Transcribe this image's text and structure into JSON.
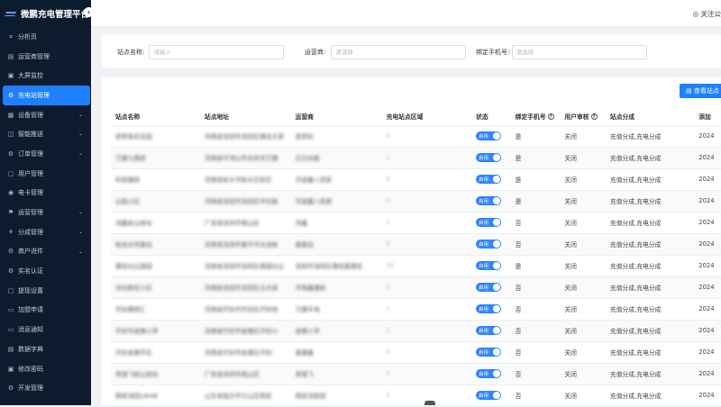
{
  "app": {
    "title": "微鹏充电管理平台",
    "collapse_icon": "‹"
  },
  "topbar": {
    "follow_label": "关注公"
  },
  "sidebar": {
    "items": [
      {
        "label": "分析页",
        "icon": "chart-icon",
        "glyph": "⌗",
        "arrow": false
      },
      {
        "label": "运营商管理",
        "icon": "doc-icon",
        "glyph": "▤",
        "arrow": false
      },
      {
        "label": "大屏监控",
        "icon": "monitor-icon",
        "glyph": "▣",
        "arrow": false
      },
      {
        "label": "充电站管理",
        "icon": "gear-icon",
        "glyph": "⚙",
        "arrow": false,
        "active": true
      },
      {
        "label": "设备管理",
        "icon": "device-icon",
        "glyph": "▦",
        "arrow": true
      },
      {
        "label": "智能推送",
        "icon": "push-icon",
        "glyph": "◫",
        "arrow": true
      },
      {
        "label": "订单管理",
        "icon": "order-icon",
        "glyph": "⚙",
        "arrow": true
      },
      {
        "label": "用户管理",
        "icon": "user-icon",
        "glyph": "▢",
        "arrow": false
      },
      {
        "label": "电卡管理",
        "icon": "card-icon",
        "glyph": "◉",
        "arrow": false
      },
      {
        "label": "运营管理",
        "icon": "operate-icon",
        "glyph": "⚑",
        "arrow": true
      },
      {
        "label": "分成管理",
        "icon": "share-icon",
        "glyph": "⚘",
        "arrow": true
      },
      {
        "label": "商户进件",
        "icon": "merchant-icon",
        "glyph": "⚙",
        "arrow": true
      },
      {
        "label": "实名认证",
        "icon": "verify-icon",
        "glyph": "⚙",
        "arrow": false
      },
      {
        "label": "提现设置",
        "icon": "withdraw-icon",
        "glyph": "▢",
        "arrow": false
      },
      {
        "label": "加盟申请",
        "icon": "apply-icon",
        "glyph": "▭",
        "arrow": false
      },
      {
        "label": "消息通知",
        "icon": "message-icon",
        "glyph": "▭",
        "arrow": false
      },
      {
        "label": "数据字典",
        "icon": "dict-icon",
        "glyph": "▤",
        "arrow": false
      },
      {
        "label": "修改密码",
        "icon": "lock-icon",
        "glyph": "▣",
        "arrow": false
      },
      {
        "label": "开发管理",
        "icon": "dev-icon",
        "glyph": "⚙",
        "arrow": false
      }
    ]
  },
  "search": {
    "station_name_label": "站点名称:",
    "station_name_placeholder": "请输入",
    "operator_label": "运营商:",
    "operator_placeholder": "请选择",
    "phone_label": "绑定手机号",
    "phone_placeholder": "请选择"
  },
  "actions": {
    "view_label": "查看站点"
  },
  "table": {
    "headers": [
      "站点名称",
      "站点地址",
      "运营商",
      "充电站点区域",
      "状态",
      "绑定手机号",
      "用户审核",
      "站点分成",
      "添加"
    ],
    "rows": [
      {
        "name": "碧翠泰彩花园",
        "addr": "河南省洛阳市洛阳区惠佳大家",
        "op": "碧翠彩",
        "area": "0",
        "status": "启用",
        "bind": "是",
        "audit": "关闭",
        "share": "充值分成,充电分成",
        "added": "2024"
      },
      {
        "name": "万康九鼎府",
        "addr": "河南省平顶山市长府市万康",
        "op": "日日出能",
        "area": "1",
        "status": "启用",
        "bind": "是",
        "audit": "关闭",
        "share": "充值分成,充电分成",
        "added": "2024"
      },
      {
        "name": "科苑雅苑",
        "addr": "河南省新乡市新乡区新区",
        "op": "洪波鑫八高家",
        "area": "0",
        "status": "启用",
        "bind": "是",
        "audit": "关闭",
        "share": "充值分成,充电分成",
        "added": "2024"
      },
      {
        "name": "云路小区",
        "addr": "河南省洛阳市洛阳区华东路",
        "op": "洪波鑫八高家",
        "area": "0",
        "status": "启用",
        "bind": "是",
        "audit": "关闭",
        "share": "充值分成,充电分成",
        "added": "2024"
      },
      {
        "name": "鸿鑫新山地址",
        "addr": "广安省深圳市南山区",
        "op": "鸿鑫",
        "area": "0",
        "status": "启用",
        "bind": "否",
        "audit": "关闭",
        "share": "充值分成,充电分成",
        "added": "2024"
      },
      {
        "name": "帐充水世嘉站",
        "addr": "河南省洛阳市嘉平市水充帐",
        "op": "嘉嘉站",
        "area": "0",
        "status": "启用",
        "bind": "否",
        "audit": "关闭",
        "share": "充值分成,充电分成",
        "added": "2024"
      },
      {
        "name": "康佳白云国园",
        "addr": "河南省洛阳市洛阳区嘉国白云",
        "op": "洛阳市洛阳区康佳嘉康宏",
        "area": "50",
        "status": "启用",
        "bind": "是",
        "audit": "关闭",
        "share": "充值分成,充电分成",
        "added": "2024"
      },
      {
        "name": "洪达鲜花小区",
        "addr": "河南省洛阳市洛阳区北大家",
        "op": "洪电鑫康新",
        "area": "0",
        "status": "启用",
        "bind": "否",
        "audit": "关闭",
        "share": "充值分成,充电分成",
        "added": "2024"
      },
      {
        "name": "开封康德汇",
        "addr": "河南省开封市开封区开封地",
        "op": "万康丰电",
        "area": "1",
        "status": "启用",
        "bind": "否",
        "audit": "关闭",
        "share": "充值分成,充电分成",
        "added": "2024"
      },
      {
        "name": "开封市金豫小学",
        "addr": "河南省开封市金豫区开封小",
        "op": "金豫小学",
        "area": "2",
        "status": "启用",
        "bind": "否",
        "audit": "关闭",
        "share": "充值分成,充电分成",
        "added": "2024"
      },
      {
        "name": "开封金豫开区",
        "addr": "河南省开封市金豫区开封",
        "op": "嘉康鑫",
        "area": "0",
        "status": "启用",
        "bind": "否",
        "audit": "关闭",
        "share": "充值分成,充电分成",
        "added": "2024"
      },
      {
        "name": "翠城飞新山地址",
        "addr": "广安省深圳市南山区",
        "op": "翠城飞",
        "area": "0",
        "status": "启用",
        "bind": "否",
        "audit": "关闭",
        "share": "充值分成,充电分成",
        "added": "2024"
      },
      {
        "name": "翔安诗园1#4#",
        "addr": "山东省临沂市兰山区翔安",
        "op": "翔安诗新园",
        "area": "2",
        "status": "启用",
        "bind": "否",
        "audit": "关闭",
        "share": "充值分成,充电分成",
        "added": "2024"
      }
    ]
  },
  "colors": {
    "sidebar_bg": "#0d1b2e",
    "accent": "#1e80ff"
  }
}
